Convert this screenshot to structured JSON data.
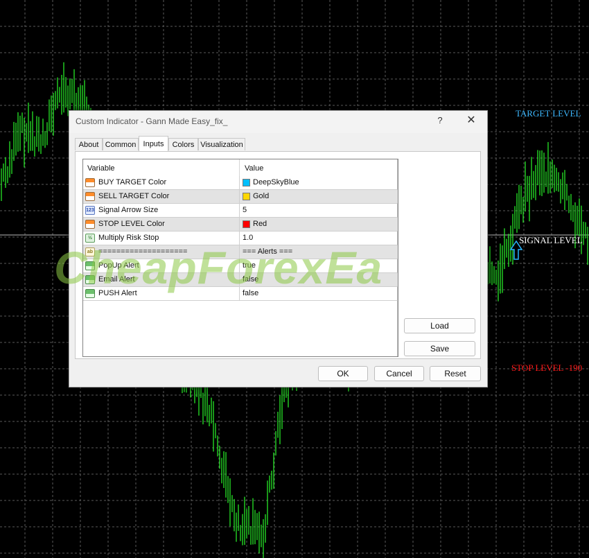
{
  "chart": {
    "background": "#000000",
    "grid_color": "#5a5a5a",
    "bar_color": "#27e827",
    "labels": {
      "target": "TARGET LEVEL",
      "signal": "SIGNAL LEVEL",
      "stop": "STOP LEVEL -190"
    }
  },
  "watermark": "CheapForexEa",
  "dialog": {
    "title": "Custom Indicator - Gann Made Easy_fix_",
    "help_icon": "?",
    "close_icon": "✕",
    "tabs": [
      {
        "label": "About",
        "active": false
      },
      {
        "label": "Common",
        "active": false
      },
      {
        "label": "Inputs",
        "active": true
      },
      {
        "label": "Colors",
        "active": false
      },
      {
        "label": "Visualization",
        "active": false
      }
    ],
    "grid": {
      "header": {
        "variable": "Variable",
        "value": "Value"
      },
      "rows": [
        {
          "icon": "color-icon",
          "name": "BUY TARGET Color",
          "value": "DeepSkyBlue",
          "swatch": "#00bfff"
        },
        {
          "icon": "color-icon",
          "name": "SELL TARGET Color",
          "value": "Gold",
          "swatch": "#ffd700"
        },
        {
          "icon": "integer-icon",
          "name": "Signal Arrow Size",
          "value": "5"
        },
        {
          "icon": "color-icon",
          "name": "STOP LEVEL Color",
          "value": "Red",
          "swatch": "#ff0000"
        },
        {
          "icon": "double-icon",
          "name": "Multiply Risk Stop",
          "value": "1.0"
        },
        {
          "icon": "string-icon",
          "name": "====================",
          "value": "=== Alerts ==="
        },
        {
          "icon": "boolean-icon",
          "name": "PopUp Alert",
          "value": "true"
        },
        {
          "icon": "boolean-icon",
          "name": "Email Alert",
          "value": "false"
        },
        {
          "icon": "boolean-icon",
          "name": "PUSH Alert",
          "value": "false"
        }
      ]
    },
    "buttons": {
      "load": "Load",
      "save": "Save",
      "ok": "OK",
      "cancel": "Cancel",
      "reset": "Reset"
    }
  }
}
